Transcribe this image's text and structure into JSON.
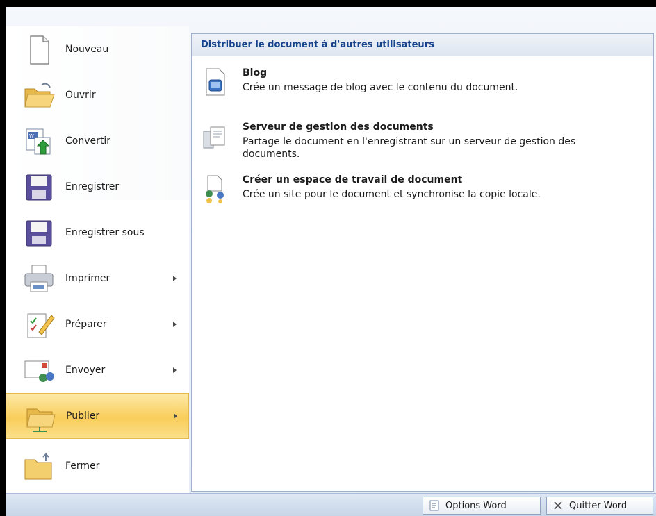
{
  "menu": {
    "items": [
      {
        "label": "Nouveau",
        "icon": "new-document-icon",
        "submenu": false
      },
      {
        "label": "Ouvrir",
        "icon": "open-folder-icon",
        "submenu": false
      },
      {
        "label": "Convertir",
        "icon": "convert-icon",
        "submenu": false
      },
      {
        "label": "Enregistrer",
        "icon": "save-icon",
        "submenu": false
      },
      {
        "label": "Enregistrer sous",
        "icon": "save-as-icon",
        "submenu": false
      },
      {
        "label": "Imprimer",
        "icon": "printer-icon",
        "submenu": true
      },
      {
        "label": "Préparer",
        "icon": "prepare-icon",
        "submenu": true
      },
      {
        "label": "Envoyer",
        "icon": "send-icon",
        "submenu": true
      },
      {
        "label": "Publier",
        "icon": "publish-icon",
        "submenu": true,
        "active": true
      },
      {
        "label": "Fermer",
        "icon": "close-folder-icon",
        "submenu": false
      }
    ]
  },
  "panel": {
    "header": "Distribuer le document à d'autres utilisateurs",
    "options": [
      {
        "title": "Blog",
        "description": "Crée un message de blog avec le contenu du document.",
        "icon": "blog-icon"
      },
      {
        "title": "Serveur de gestion des documents",
        "description": "Partage le document en l'enregistrant sur un serveur de gestion des documents.",
        "icon": "document-server-icon"
      },
      {
        "title": "Créer un espace de travail de document",
        "description": "Crée un site pour le document et synchronise la copie locale.",
        "icon": "workspace-icon"
      }
    ]
  },
  "footer": {
    "options_label": "Options Word",
    "quit_label": "Quitter Word"
  },
  "colors": {
    "accent": "#f9cd5a",
    "header_text": "#15428b",
    "panel_border": "#9fb2cc"
  }
}
